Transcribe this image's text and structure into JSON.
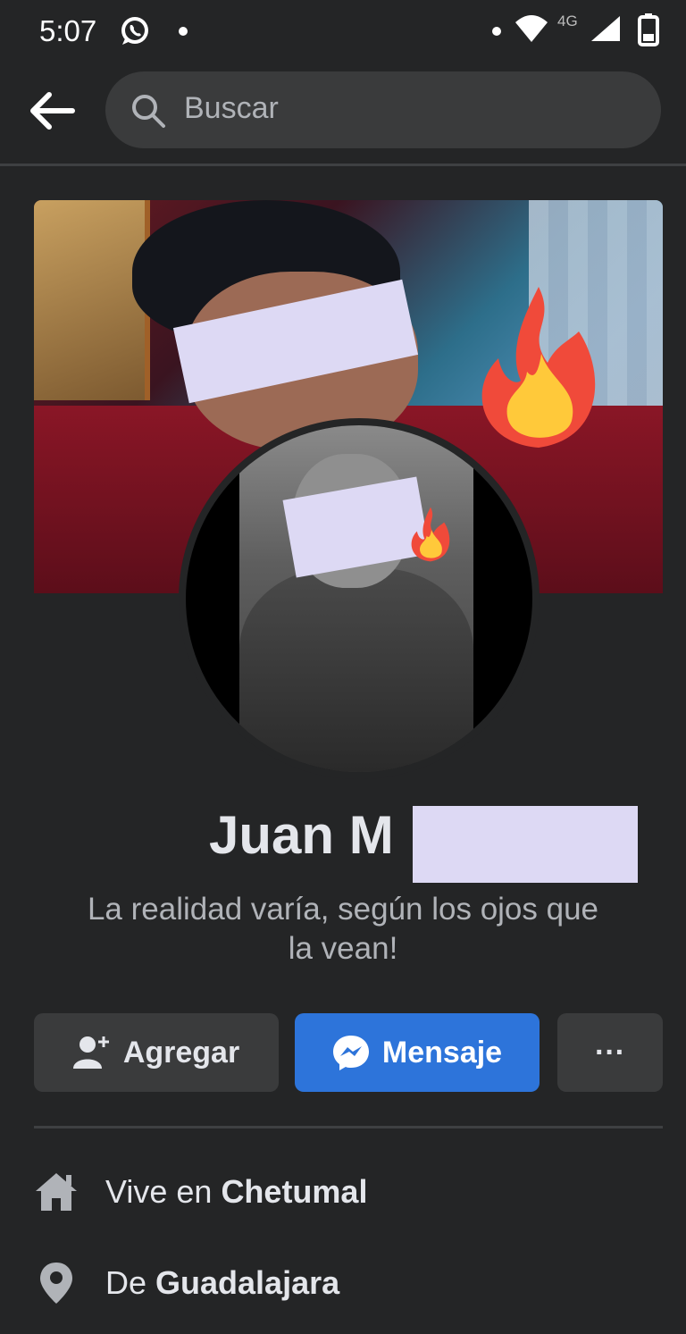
{
  "status_bar": {
    "time": "5:07",
    "network": "4G",
    "icons": [
      "whatsapp-icon",
      "wifi-icon",
      "signal-icon",
      "battery-icon"
    ]
  },
  "top_bar": {
    "search_placeholder": "Buscar"
  },
  "profile": {
    "name_visible": "Juan M",
    "bio": "La realidad varía, según los ojos que la vean!"
  },
  "actions": {
    "add_label": "Agregar",
    "message_label": "Mensaje",
    "more_label": "···"
  },
  "info": {
    "lives_prefix": "Vive en",
    "lives_city": "Chetumal",
    "from_prefix": "De",
    "from_city": "Guadalajara"
  },
  "colors": {
    "background": "#242526",
    "message_button": "#2d74da",
    "secondary_button": "#3a3b3c",
    "censor_bar": "#ddd9f4"
  }
}
